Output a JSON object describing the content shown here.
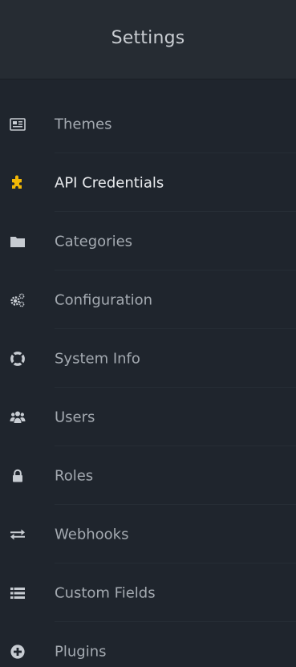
{
  "header": {
    "title": "Settings"
  },
  "colors": {
    "background": "#1f252d",
    "header_background": "#262c33",
    "text": "#a4aab1",
    "active_text": "#e8eaed",
    "active_icon": "#f2b705"
  },
  "menu": {
    "items": [
      {
        "label": "Themes",
        "icon": "themes-icon"
      },
      {
        "label": "API Credentials",
        "icon": "puzzle-icon",
        "active": true
      },
      {
        "label": "Categories",
        "icon": "folder-icon"
      },
      {
        "label": "Configuration",
        "icon": "gears-icon"
      },
      {
        "label": "System Info",
        "icon": "life-ring-icon"
      },
      {
        "label": "Users",
        "icon": "users-icon"
      },
      {
        "label": "Roles",
        "icon": "lock-icon"
      },
      {
        "label": "Webhooks",
        "icon": "exchange-icon"
      },
      {
        "label": "Custom Fields",
        "icon": "list-icon"
      },
      {
        "label": "Plugins",
        "icon": "plus-circle-icon"
      }
    ]
  }
}
